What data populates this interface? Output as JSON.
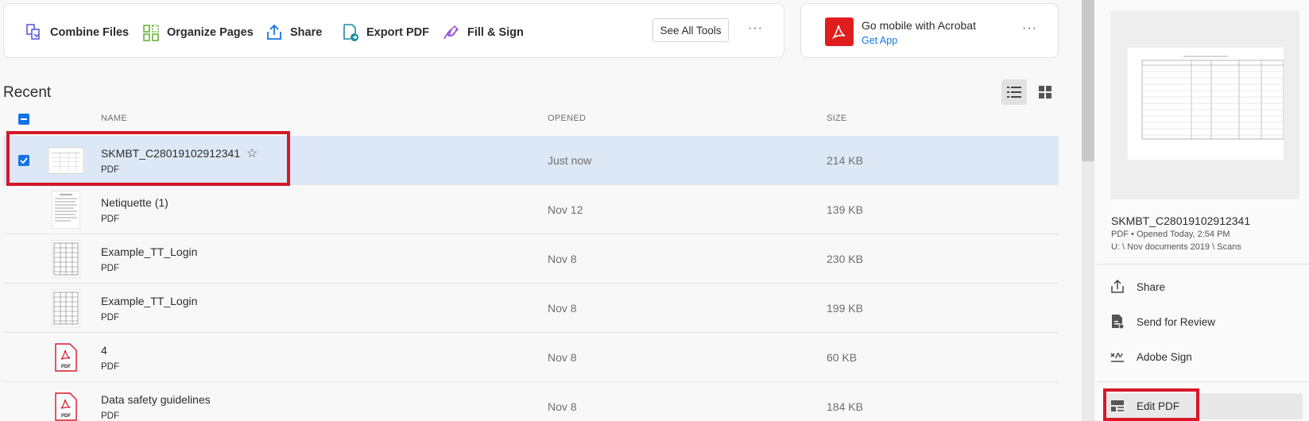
{
  "toolbar": {
    "tools": [
      {
        "label": "Combine Files",
        "icon": "combine-files-icon"
      },
      {
        "label": "Organize Pages",
        "icon": "organize-pages-icon"
      },
      {
        "label": "Share",
        "icon": "share-icon"
      },
      {
        "label": "Export PDF",
        "icon": "export-pdf-icon"
      },
      {
        "label": "Fill & Sign",
        "icon": "fill-sign-icon"
      }
    ],
    "see_all": "See All Tools",
    "more": "···"
  },
  "promo": {
    "title": "Go mobile with Acrobat",
    "link": "Get App",
    "more": "···"
  },
  "recent": {
    "title": "Recent",
    "columns": {
      "name": "NAME",
      "opened": "OPENED",
      "size": "SIZE"
    },
    "files": [
      {
        "name": "SKMBT_C28019102912341",
        "type": "PDF",
        "opened": "Just now",
        "size": "214 KB",
        "selected": true,
        "thumb": "scan-table"
      },
      {
        "name": "Netiquette (1)",
        "type": "PDF",
        "opened": "Nov 12",
        "size": "139 KB",
        "thumb": "text-doc"
      },
      {
        "name": "Example_TT_Login",
        "type": "PDF",
        "opened": "Nov 8",
        "size": "230 KB",
        "thumb": "table-doc"
      },
      {
        "name": "Example_TT_Login",
        "type": "PDF",
        "opened": "Nov 8",
        "size": "199 KB",
        "thumb": "table-doc"
      },
      {
        "name": "4",
        "type": "PDF",
        "opened": "Nov 8",
        "size": "60 KB",
        "thumb": "pdf-icon"
      },
      {
        "name": "Data safety guidelines",
        "type": "PDF",
        "opened": "Nov 8",
        "size": "184 KB",
        "thumb": "pdf-icon"
      }
    ]
  },
  "details": {
    "title": "SKMBT_C28019102912341",
    "meta": "PDF  •  Opened Today, 2:54 PM",
    "path": "U: \\ Nov documents 2019 \\ Scans",
    "actions": [
      {
        "label": "Share",
        "icon": "share-icon"
      },
      {
        "label": "Send for Review",
        "icon": "send-review-icon"
      },
      {
        "label": "Adobe Sign",
        "icon": "adobe-sign-icon"
      },
      {
        "label": "Edit PDF",
        "icon": "edit-pdf-icon"
      }
    ]
  },
  "pdf_badge": "PDF",
  "colors": {
    "accent": "#1473e6",
    "highlight": "#d7182a",
    "selected_row": "#dde8f6"
  }
}
